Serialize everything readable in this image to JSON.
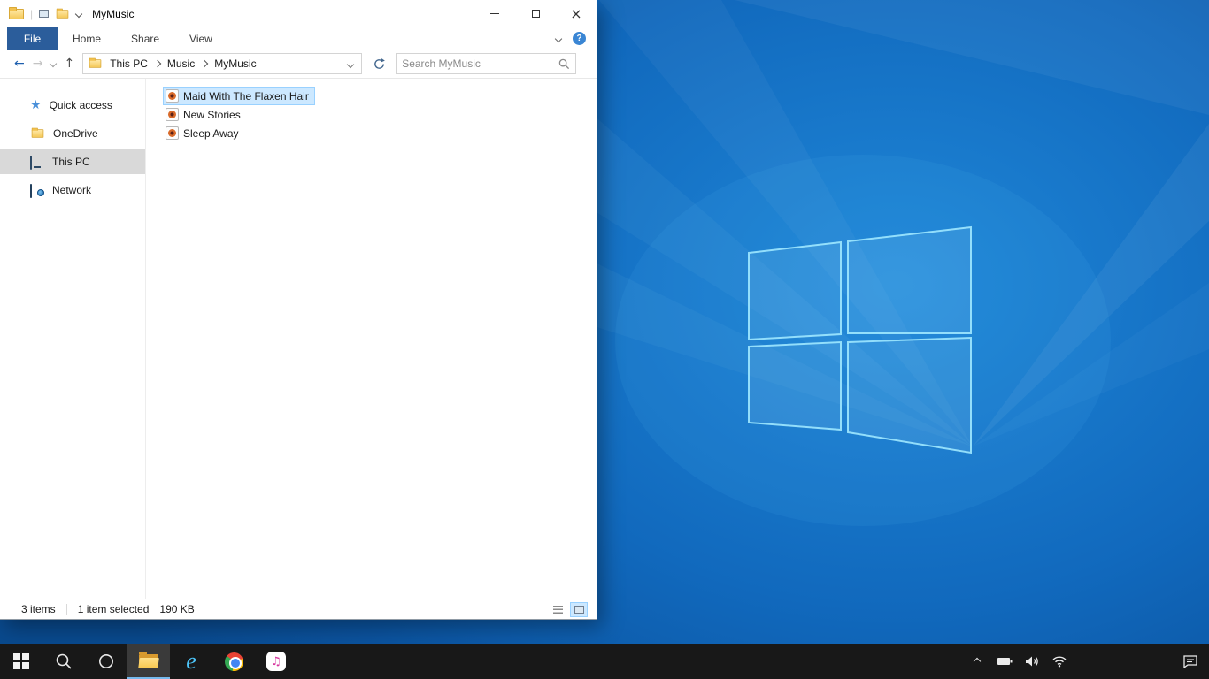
{
  "window": {
    "title": "MyMusic",
    "tabs": {
      "file": "File",
      "home": "Home",
      "share": "Share",
      "view": "View"
    },
    "address": {
      "crumbs": [
        "This PC",
        "Music",
        "MyMusic"
      ],
      "search_placeholder": "Search MyMusic"
    },
    "sidebar": {
      "items": [
        {
          "label": "Quick access",
          "icon": "star-icon"
        },
        {
          "label": "OneDrive",
          "icon": "folder-icon"
        },
        {
          "label": "This PC",
          "icon": "computer-icon",
          "selected": true
        },
        {
          "label": "Network",
          "icon": "network-icon"
        }
      ]
    },
    "files": [
      {
        "name": "Maid With The Flaxen Hair",
        "icon": "music-file-icon",
        "selected": true
      },
      {
        "name": "New Stories",
        "icon": "music-file-icon",
        "selected": false
      },
      {
        "name": "Sleep Away",
        "icon": "music-file-icon",
        "selected": false
      }
    ],
    "status": {
      "count": "3 items",
      "selected": "1 item selected",
      "size": "190 KB"
    }
  },
  "taskbar": {
    "icons": [
      "start",
      "search",
      "cortana",
      "file-explorer",
      "internet-explorer",
      "chrome",
      "itunes"
    ],
    "tray_icons": [
      "chevron-up",
      "battery",
      "volume",
      "wifi",
      "action-center"
    ]
  },
  "colors": {
    "file_tab": "#2b5d9b",
    "selection_bg": "#cce8ff",
    "selection_border": "#99d1ff",
    "sidebar_selected": "#d9d9d9",
    "taskbar_bg": "#181818",
    "desktop_base": "#1169bd"
  }
}
